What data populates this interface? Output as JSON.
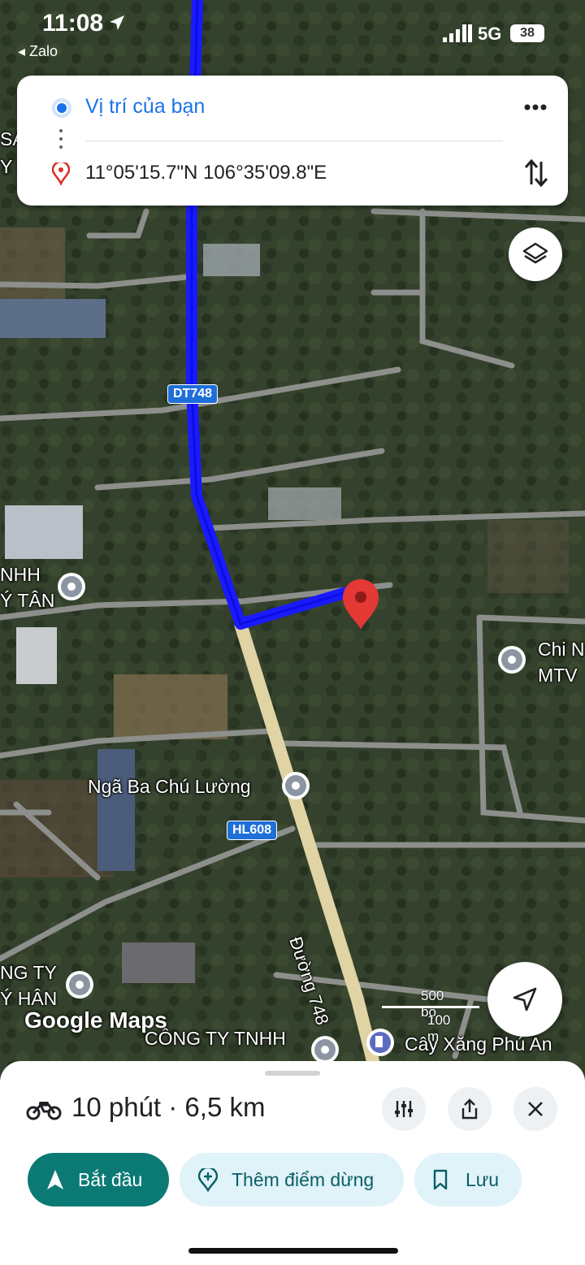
{
  "status_bar": {
    "time": "11:08",
    "back_app": "◂ Zalo",
    "network": "5G",
    "battery": "38"
  },
  "directions": {
    "origin": "Vị trí của bạn",
    "destination": "11°05'15.7\"N 106°35'09.8\"E"
  },
  "map": {
    "road_badges": [
      "DT748",
      "HL608"
    ],
    "road_name": "Đường 748",
    "places": {
      "nga_ba": "Ngã Ba Chú Lường",
      "left_company_1a": "NHH",
      "left_company_1b": "Ý TÂN",
      "right_company_a": "Chi N",
      "right_company_b": "MTV",
      "bottom_left_a": "NG TY",
      "bottom_left_b": "Ý HÂN",
      "bottom_company": "CÔNG TY TNHH",
      "gas_station": "Cây Xăng Phú An",
      "left_edge_a": "SÀ",
      "left_edge_b": "Y D"
    },
    "attribution": "Google Maps",
    "scale": {
      "label_top": "500 bộ",
      "label_bottom": "100 m"
    },
    "route_color": "#1a1aff",
    "pin_color": "#e53935"
  },
  "sheet": {
    "summary": "10 phút · 6,5 km",
    "mode_icon": "motorbike-icon",
    "start_label": "Bắt đầu",
    "add_stop_label": "Thêm điểm dừng",
    "save_label": "Lưu"
  }
}
